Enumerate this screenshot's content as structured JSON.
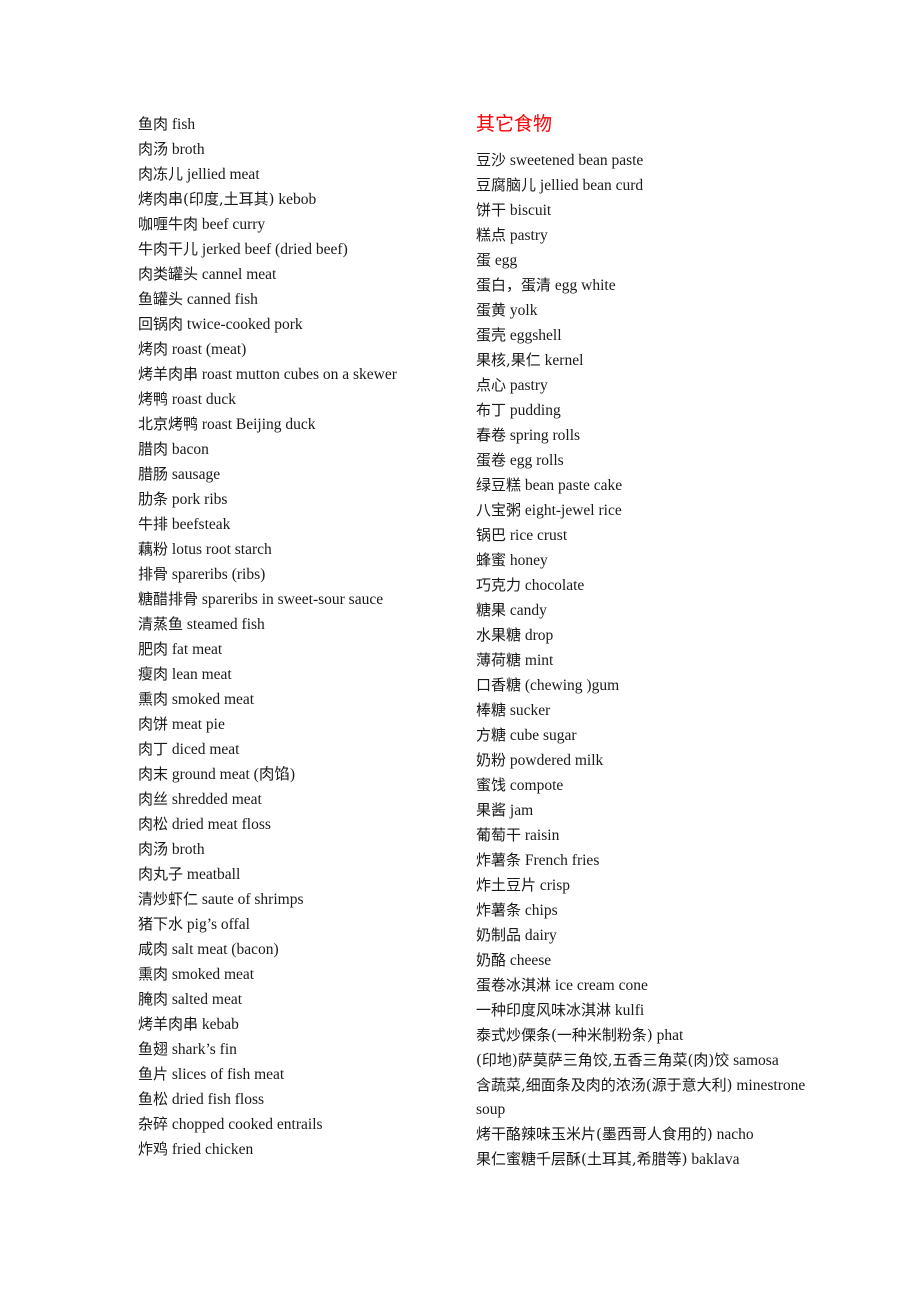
{
  "document": {
    "type": "chinese-english-food-vocabulary-list",
    "background_color": "#ffffff",
    "text_color": "#1a1a1a",
    "heading_color": "#fb0007"
  },
  "left_column": {
    "entries": [
      {
        "zh": "鱼肉",
        "en": "fish"
      },
      {
        "zh": "肉汤",
        "en": "broth"
      },
      {
        "zh": "肉冻儿",
        "en": "jellied meat"
      },
      {
        "zh": "烤肉串(印度,土耳其)",
        "en": "kebob"
      },
      {
        "zh": "咖喱牛肉",
        "en": "beef curry"
      },
      {
        "zh": "牛肉干儿",
        "en": "jerked beef (dried beef)"
      },
      {
        "zh": "肉类罐头",
        "en": "cannel meat"
      },
      {
        "zh": "鱼罐头",
        "en": "canned fish"
      },
      {
        "zh": "回锅肉",
        "en": "twice-cooked pork"
      },
      {
        "zh": "烤肉",
        "en": "roast (meat)"
      },
      {
        "zh": "烤羊肉串",
        "en": "roast mutton cubes on a skewer"
      },
      {
        "zh": "烤鸭",
        "en": "roast duck"
      },
      {
        "zh": "北京烤鸭",
        "en": "roast Beijing duck"
      },
      {
        "zh": "腊肉",
        "en": "bacon"
      },
      {
        "zh": "腊肠",
        "en": "sausage"
      },
      {
        "zh": "肋条",
        "en": "pork ribs"
      },
      {
        "zh": "牛排",
        "en": "beefsteak"
      },
      {
        "zh": "藕粉",
        "en": "lotus root starch"
      },
      {
        "zh": "排骨",
        "en": "spareribs (ribs)"
      },
      {
        "zh": "糖醋排骨",
        "en": "spareribs in sweet-sour sauce"
      },
      {
        "zh": "清蒸鱼",
        "en": "steamed fish"
      },
      {
        "zh": "肥肉",
        "en": "fat meat"
      },
      {
        "zh": "瘦肉",
        "en": "lean meat"
      },
      {
        "zh": "熏肉",
        "en": "smoked meat"
      },
      {
        "zh": "肉饼",
        "en": "meat pie"
      },
      {
        "zh": "肉丁",
        "en": "diced meat"
      },
      {
        "zh": "肉末",
        "en": "ground meat (肉馅)"
      },
      {
        "zh": "肉丝",
        "en": "shredded meat"
      },
      {
        "zh": "肉松",
        "en": "dried meat floss"
      },
      {
        "zh": "肉汤",
        "en": "broth"
      },
      {
        "zh": "肉丸子",
        "en": "meatball"
      },
      {
        "zh": "清炒虾仁",
        "en": "saute of shrimps"
      },
      {
        "zh": "猪下水",
        "en": "pig’s offal"
      },
      {
        "zh": "咸肉",
        "en": "salt meat (bacon)"
      },
      {
        "zh": "熏肉",
        "en": "smoked meat"
      },
      {
        "zh": "腌肉",
        "en": "salted meat"
      },
      {
        "zh": "烤羊肉串",
        "en": "kebab"
      },
      {
        "zh": "鱼翅",
        "en": "shark’s fin"
      },
      {
        "zh": "鱼片",
        "en": "slices of fish meat"
      },
      {
        "zh": "鱼松",
        "en": "dried fish floss"
      },
      {
        "zh": "杂碎",
        "en": "chopped cooked entrails"
      },
      {
        "zh": "炸鸡",
        "en": "fried chicken"
      }
    ]
  },
  "right_column": {
    "heading": "其它食物",
    "entries": [
      {
        "zh": "豆沙",
        "en": "sweetened bean paste"
      },
      {
        "zh": "豆腐脑儿",
        "en": "jellied bean curd"
      },
      {
        "zh": "饼干",
        "en": "biscuit"
      },
      {
        "zh": "糕点",
        "en": "pastry"
      },
      {
        "zh": "蛋",
        "en": "egg"
      },
      {
        "zh": "蛋白，蛋清",
        "en": "egg white"
      },
      {
        "zh": "蛋黄",
        "en": "yolk"
      },
      {
        "zh": "蛋壳",
        "en": "eggshell"
      },
      {
        "zh": "果核,果仁",
        "en": "kernel"
      },
      {
        "zh": "点心",
        "en": "pastry"
      },
      {
        "zh": "布丁",
        "en": "pudding"
      },
      {
        "zh": "春卷",
        "en": "spring rolls"
      },
      {
        "zh": "蛋卷",
        "en": "egg rolls"
      },
      {
        "zh": "绿豆糕",
        "en": "bean paste cake"
      },
      {
        "zh": "八宝粥",
        "en": "eight-jewel rice"
      },
      {
        "zh": "锅巴",
        "en": "rice crust"
      },
      {
        "zh": "蜂蜜",
        "en": "honey"
      },
      {
        "zh": "巧克力",
        "en": "chocolate"
      },
      {
        "zh": "糖果",
        "en": "candy"
      },
      {
        "zh": "水果糖",
        "en": "drop"
      },
      {
        "zh": "薄荷糖",
        "en": "mint"
      },
      {
        "zh": "口香糖",
        "en": "(chewing )gum"
      },
      {
        "zh": "棒糖",
        "en": "sucker"
      },
      {
        "zh": "方糖",
        "en": "cube sugar"
      },
      {
        "zh": "奶粉",
        "en": "powdered milk"
      },
      {
        "zh": "蜜饯",
        "en": "compote"
      },
      {
        "zh": "果酱",
        "en": "jam"
      },
      {
        "zh": "葡萄干",
        "en": "raisin"
      },
      {
        "zh": "炸薯条",
        "en": "French fries"
      },
      {
        "zh": "炸土豆片",
        "en": "crisp"
      },
      {
        "zh": "炸薯条",
        "en": "chips"
      },
      {
        "zh": "奶制品",
        "en": "dairy"
      },
      {
        "zh": "奶酪",
        "en": "cheese"
      },
      {
        "zh": "蛋卷冰淇淋",
        "en": "ice cream cone"
      },
      {
        "zh": "一种印度风味冰淇淋",
        "en": "kulfi"
      },
      {
        "zh": "泰式炒傈条(一种米制粉条)",
        "en": "phat"
      },
      {
        "zh": "(印地)萨莫萨三角饺,五香三角菜(肉)饺",
        "en": "samosa"
      },
      {
        "zh": "含蔬菜,细面条及肉的浓汤(源于意大利)",
        "en": "minestrone soup"
      },
      {
        "zh": "烤干酪辣味玉米片(墨西哥人食用的)",
        "en": "nacho"
      },
      {
        "zh": "果仁蜜糖千层酥(土耳其,希腊等)",
        "en": "baklava"
      }
    ]
  }
}
